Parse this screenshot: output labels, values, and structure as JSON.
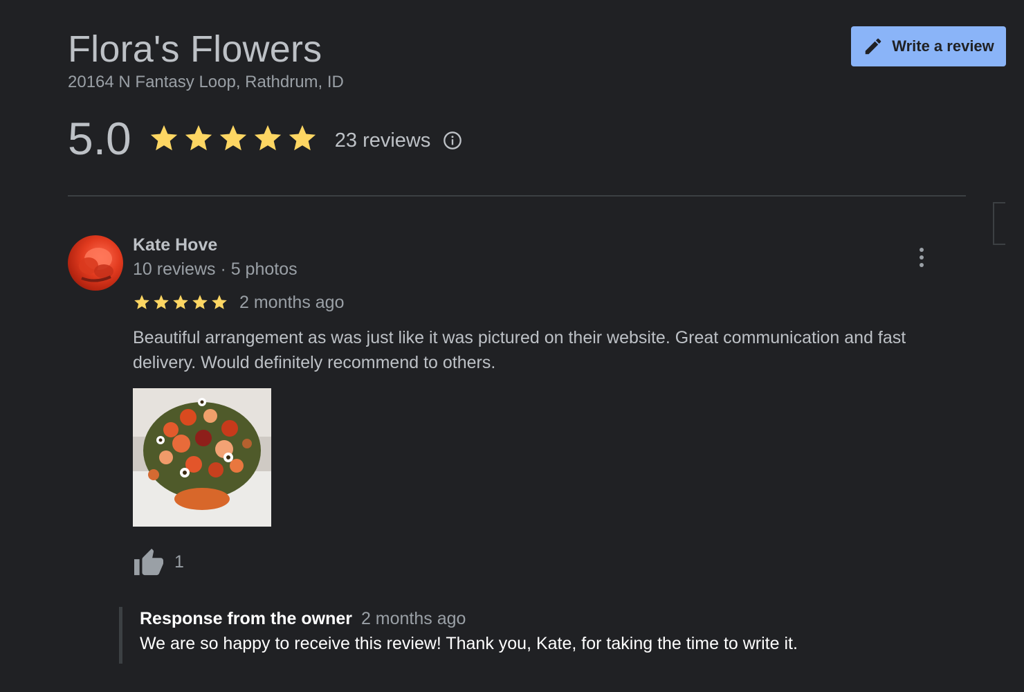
{
  "business": {
    "name": "Flora's Flowers",
    "address": "20164 N Fantasy Loop, Rathdrum, ID",
    "rating": "5.0",
    "stars": 5,
    "review_count": "23 reviews"
  },
  "actions": {
    "write_review": "Write a review"
  },
  "review": {
    "author": "Kate Hove",
    "author_meta": "10 reviews · 5 photos",
    "stars": 5,
    "date": "2 months ago",
    "text": "Beautiful arrangement as was just like it was pictured on their website. Great communication and fast delivery. Would definitely recommend to others.",
    "likes": "1",
    "owner_response": {
      "label": "Response from the owner",
      "date": "2 months ago",
      "text": "We are so happy to receive this review! Thank you, Kate, for taking the time to write it."
    }
  },
  "colors": {
    "background": "#202124",
    "accent": "#8ab4f8",
    "star": "#fdd663"
  },
  "icons": {
    "edit": "pencil-icon",
    "info": "info-icon",
    "more": "more-vert-icon",
    "like": "thumbs-up-icon"
  }
}
